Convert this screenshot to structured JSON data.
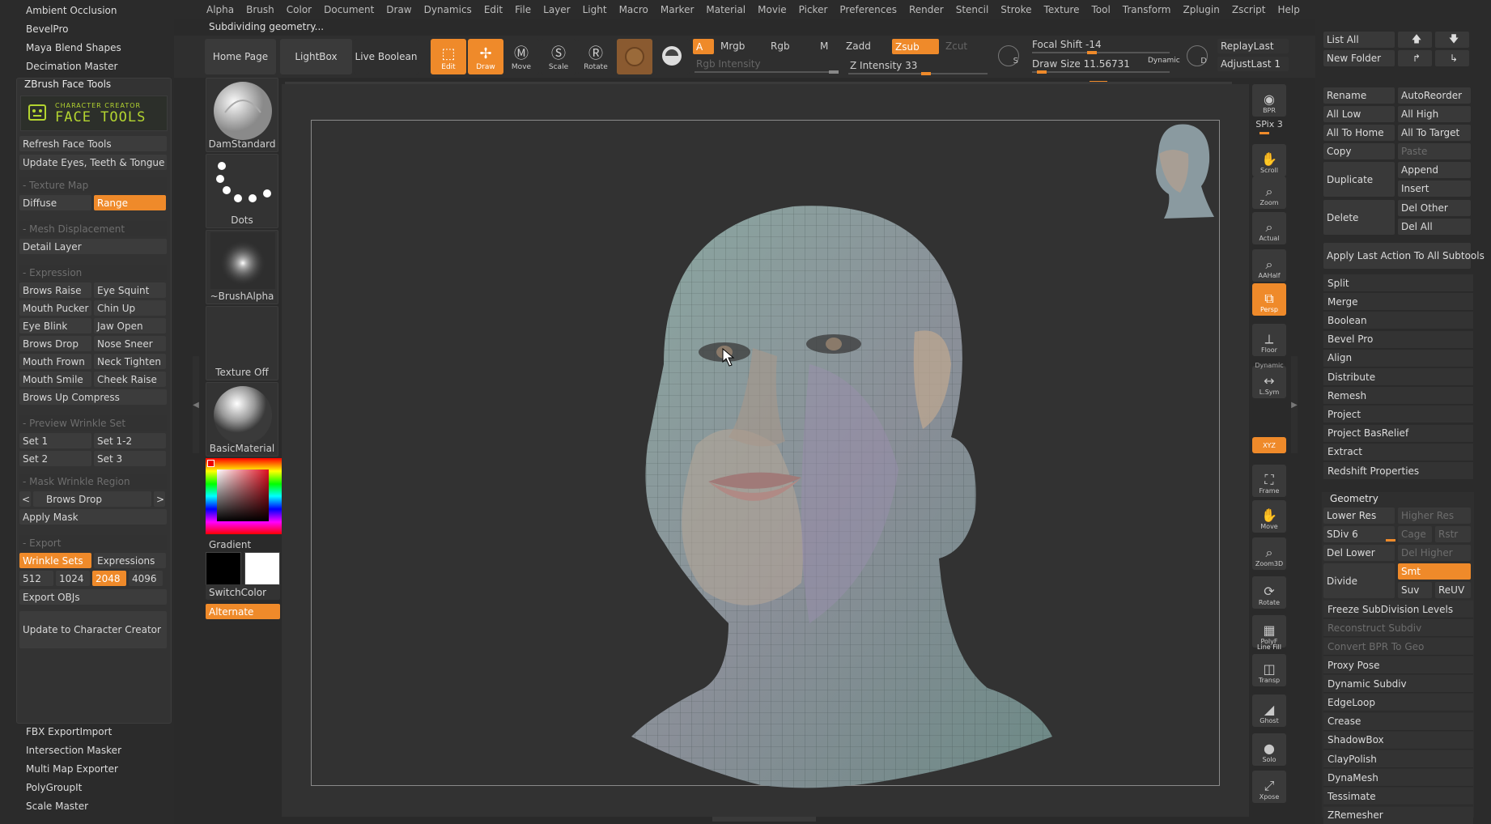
{
  "menu": [
    "Alpha",
    "Brush",
    "Color",
    "Document",
    "Draw",
    "Dynamics",
    "Edit",
    "File",
    "Layer",
    "Light",
    "Macro",
    "Marker",
    "Material",
    "Movie",
    "Picker",
    "Preferences",
    "Render",
    "Stencil",
    "Stroke",
    "Texture",
    "Tool",
    "Transform",
    "Zplugin",
    "Zscript",
    "Help"
  ],
  "status": "Subdividing geometry...",
  "left": {
    "top_items": [
      "Ambient Occlusion",
      "BevelPro",
      "Maya Blend Shapes",
      "Decimation Master"
    ],
    "tray_title": "ZBrush Face Tools",
    "logo_top": "CHARACTER CREATOR",
    "logo_main": "FACE TOOLS",
    "refresh": "Refresh Face Tools",
    "update_eyes": "Update Eyes, Teeth & Tongue",
    "texture_map": "- Texture Map",
    "diffuse": "Diffuse",
    "range": "Range",
    "mesh_disp": "- Mesh Displacement",
    "detail_layer": "Detail Layer",
    "expression": "- Expression",
    "expr_rows": [
      [
        "Brows Raise",
        "Eye Squint"
      ],
      [
        "Mouth Pucker",
        "Chin Up"
      ],
      [
        "Eye Blink",
        "Jaw Open"
      ],
      [
        "Brows Drop",
        "Nose Sneer"
      ],
      [
        "Mouth Frown",
        "Neck Tighten"
      ],
      [
        "Mouth Smile",
        "Cheek Raise"
      ]
    ],
    "brows_compress": "Brows Up Compress",
    "preview_wrinkle": "- Preview Wrinkle Set",
    "sets": [
      [
        "Set 1",
        "Set 1-2"
      ],
      [
        "Set 2",
        "Set 3"
      ]
    ],
    "mask_region": "- Mask Wrinkle Region",
    "prev": "<",
    "region": "Brows Drop",
    "next": ">",
    "apply_mask": "Apply Mask",
    "export": "- Export",
    "wrinkle_sets": "Wrinkle Sets",
    "expressions": "Expressions",
    "sizes": [
      "512",
      "1024",
      "2048",
      "4096"
    ],
    "export_objs": "Export OBJs",
    "update_cc": "Update to Character Creator",
    "bottom_items": [
      "FBX ExportImport",
      "Intersection Masker",
      "Multi Map Exporter",
      "PolyGroupIt",
      "Scale Master"
    ]
  },
  "toolbar": {
    "home": "Home Page",
    "lightbox": "LightBox",
    "live_boolean": "Live Boolean",
    "edit": "Edit",
    "draw": "Draw",
    "move": "Move",
    "scale": "Scale",
    "rotate": "Rotate",
    "a": "A",
    "mrgb": "Mrgb",
    "rgb": "Rgb",
    "m": "M",
    "rgb_intensity": "Rgb Intensity",
    "zadd": "Zadd",
    "zsub": "Zsub",
    "zcut": "Zcut",
    "z_intensity": "Z Intensity 33",
    "focal_shift": "Focal Shift -14",
    "draw_size": "Draw Size 11.56731",
    "dynamic": "Dynamic",
    "s": "S",
    "d": "D",
    "replay_last": "ReplayLast",
    "adjust_last": "AdjustLast 1"
  },
  "brushes": [
    {
      "label": "DamStandard"
    },
    {
      "label": "Dots"
    },
    {
      "label": "~BrushAlpha"
    },
    {
      "label": "Texture Off"
    },
    {
      "label": "BasicMaterial"
    }
  ],
  "color": {
    "gradient": "Gradient",
    "switch": "SwitchColor",
    "alternate": "Alternate"
  },
  "dock": [
    "BPR",
    "SPix 3",
    "Scroll",
    "Zoom",
    "Actual",
    "AAHalf",
    "Persp",
    "Floor",
    "L.Sym",
    "XYZ",
    "Frame",
    "Move",
    "Zoom3D",
    "Rotate",
    "PolyF",
    "Transp",
    "Ghost",
    "Solo",
    "Xpose"
  ],
  "dock_text": {
    "dynamic": "Dynamic",
    "line_fill": "Line Fill"
  },
  "right": {
    "list_all": "List All",
    "new_folder": "New Folder",
    "rename": "Rename",
    "autoreorder": "AutoReorder",
    "all_low": "All Low",
    "all_high": "All High",
    "all_to_home": "All To Home",
    "all_to_target": "All To Target",
    "copy": "Copy",
    "paste": "Paste",
    "duplicate": "Duplicate",
    "append": "Append",
    "insert": "Insert",
    "delete": "Delete",
    "del_other": "Del Other",
    "del_all": "Del All",
    "apply_last": "Apply Last Action To All Subtools",
    "list1": [
      "Split",
      "Merge",
      "Boolean",
      "Bevel Pro",
      "Align",
      "Distribute",
      "Remesh",
      "Project",
      "Project BasRelief",
      "Extract",
      "Redshift Properties"
    ],
    "geometry": "Geometry",
    "lower_res": "Lower Res",
    "higher_res": "Higher Res",
    "sdiv": "SDiv 6",
    "cage": "Cage",
    "rstr": "Rstr",
    "del_lower": "Del Lower",
    "del_higher": "Del Higher",
    "divide": "Divide",
    "smt": "Smt",
    "suv": "Suv",
    "reuv": "ReUV",
    "freeze": "Freeze SubDivision Levels",
    "reconstruct": "Reconstruct Subdiv",
    "convert_bpr": "Convert BPR To Geo",
    "list2": [
      "Proxy Pose",
      "Dynamic Subdiv",
      "EdgeLoop",
      "Crease",
      "ShadowBox",
      "ClayPolish",
      "DynaMesh",
      "Tessimate",
      "ZRemesher"
    ]
  },
  "colors": {
    "accent": "#ef8a2a",
    "panel": "#333333",
    "bg": "#2b2b2b"
  }
}
